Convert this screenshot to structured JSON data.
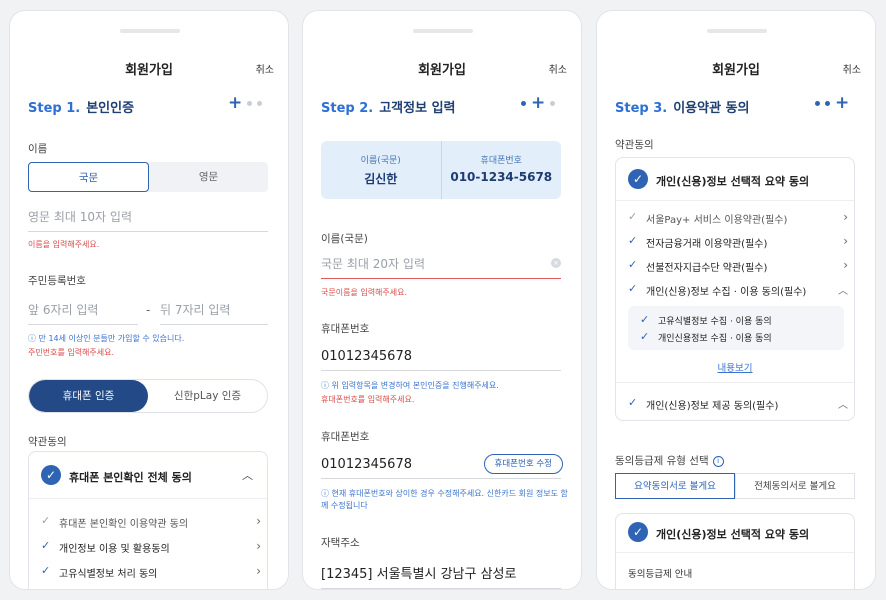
{
  "header": {
    "title": "회원가입",
    "cancel": "취소"
  },
  "step1": {
    "step_no": "Step 1.",
    "step_title": "본인인증",
    "name_label": "이름",
    "name_tabs": [
      "국문",
      "영문"
    ],
    "name_placeholder": "영문 최대 10자 입력",
    "name_error": "이름을 입력해주세요.",
    "rrn_label": "주민등록번호",
    "rrn_front_placeholder": "앞 6자리 입력",
    "rrn_dash": "-",
    "rrn_back_placeholder": "뒤 7자리 입력",
    "rrn_info": "ⓘ 만 14세 이상인 분들만 가입할 수 있습니다.",
    "rrn_error": "주민번호를 입력해주세요.",
    "auth_tabs": [
      "휴대폰 인증",
      "신한pLay 인증"
    ],
    "terms_label": "약관동의",
    "terms_all": "휴대폰 본인확인 전체 동의",
    "terms_items": [
      "휴대폰 본인확인 이용약관 동의",
      "개인정보 이용 및 활용동의",
      "고유식별정보 처리 동의"
    ]
  },
  "step2": {
    "step_no": "Step 2.",
    "step_title": "고객정보 입력",
    "card_name_label": "이름(국문)",
    "card_name_value": "김신한",
    "card_phone_label": "휴대폰번호",
    "card_phone_value": "010-1234-5678",
    "name_label": "이름(국문)",
    "name_placeholder": "국문 최대 20자 입력",
    "name_error": "국문이름을 입력해주세요.",
    "phone_label": "휴대폰번호",
    "phone_value": "01012345678",
    "phone_info": "ⓘ 위 입력항목을 변경하여 본인인증을 진행해주세요.",
    "phone_error": "휴대폰번호를 입력해주세요.",
    "phone2_label": "휴대폰번호",
    "phone2_value": "01012345678",
    "phone2_button": "휴대폰번호 수정",
    "phone2_info": "ⓘ 현재 휴대폰번호와 상이한 경우 수정해주세요. 신한카드 회원 정보도 함께 수정됩니다",
    "address_label": "자택주소",
    "address_value": "[12345] 서울특별시 강남구 삼성로"
  },
  "step3": {
    "step_no": "Step 3.",
    "step_title": "이용약관 동의",
    "terms_label": "약관동의",
    "summary_title": "개인(신용)정보 선택적 요약 동의",
    "items": [
      "서울Pay+ 서비스 이용약관(필수)",
      "전자금융거래 이용약관(필수)",
      "선불전자지급수단 약관(필수)",
      "개인(신용)정보 수집 · 이용 동의(필수)"
    ],
    "sub_items": [
      "고유식별정보 수집 · 이용 동의",
      "개인신용정보 수집 · 이용 동의"
    ],
    "view_link": "내용보기",
    "provide_item": "개인(신용)정보 제공 동의(필수)",
    "level_label": "동의등급제 유형 선택",
    "level_info_icon": "i",
    "level_tabs": [
      "요약동의서로 볼게요",
      "전체동의서로 볼게요"
    ],
    "summary2_title": "개인(신용)정보 선택적 요약 동의",
    "level_guide": "동의등급제 안내"
  },
  "colors": {
    "accent": "#2f63b4",
    "navy": "#1f3f73",
    "error": "#d94a4a"
  }
}
